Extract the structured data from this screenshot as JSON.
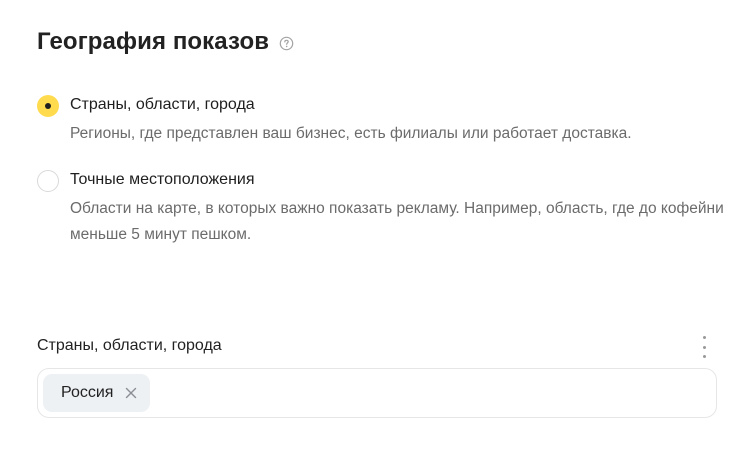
{
  "section": {
    "title": "География показов",
    "help_icon": "question-circle-icon"
  },
  "radio_options": [
    {
      "label": "Страны, области, города",
      "description": "Регионы, где представлен ваш бизнес, есть филиалы или работает доставка.",
      "checked": true
    },
    {
      "label": "Точные местоположения",
      "description": "Области на карте, в которых важно показать рекламу. Например, область, где до кофейни меньше 5 минут пешком.",
      "checked": false
    }
  ],
  "regions_field": {
    "label": "Страны, области, города",
    "more_icon": "more-vertical-icon",
    "tags": [
      {
        "label": "Россия",
        "remove_icon": "close-icon"
      }
    ]
  },
  "colors": {
    "accent": "#ffdb4d",
    "text_primary": "#1f1f1f",
    "text_secondary": "#6b6b6b",
    "tag_background": "#eef1f4"
  }
}
